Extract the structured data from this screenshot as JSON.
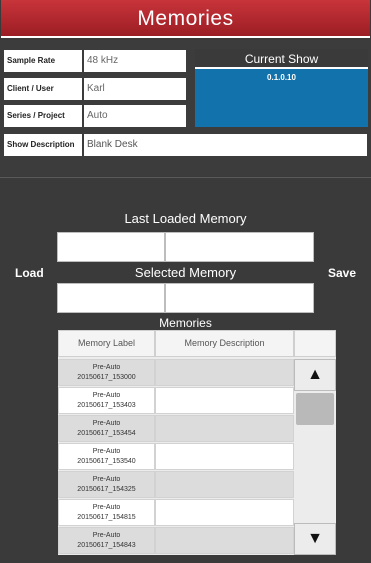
{
  "title": "Memories",
  "info": {
    "sample_rate_label": "Sample Rate",
    "sample_rate_value": "48 kHz",
    "client_label": "Client / User",
    "client_value": "Karl",
    "series_label": "Series / Project",
    "series_value": "Auto",
    "description_label": "Show Description",
    "description_value": "Blank Desk"
  },
  "current_show": {
    "title": "Current Show",
    "version": "0.1.0.10"
  },
  "memories_panel": {
    "last_loaded_title": "Last Loaded Memory",
    "selected_title": "Selected Memory",
    "load_label": "Load",
    "save_label": "Save",
    "list_title": "Memories",
    "columns": [
      "Memory Label",
      "Memory Description"
    ],
    "rows": [
      {
        "label_line1": "Pre-Auto",
        "label_line2": "20150617_153000",
        "description": ""
      },
      {
        "label_line1": "Pre-Auto",
        "label_line2": "20150617_153403",
        "description": ""
      },
      {
        "label_line1": "Pre-Auto",
        "label_line2": "20150617_153454",
        "description": ""
      },
      {
        "label_line1": "Pre-Auto",
        "label_line2": "20150617_153540",
        "description": ""
      },
      {
        "label_line1": "Pre-Auto",
        "label_line2": "20150617_154325",
        "description": ""
      },
      {
        "label_line1": "Pre-Auto",
        "label_line2": "20150617_154815",
        "description": ""
      },
      {
        "label_line1": "Pre-Auto",
        "label_line2": "20150617_154843",
        "description": ""
      }
    ],
    "scroll_up_icon": "up-arrow-icon",
    "scroll_down_icon": "down-arrow-icon"
  },
  "colors": {
    "title_bar": "#b3262c",
    "current_show_bg": "#1273ac",
    "panel_bg": "#3a3a3a"
  }
}
